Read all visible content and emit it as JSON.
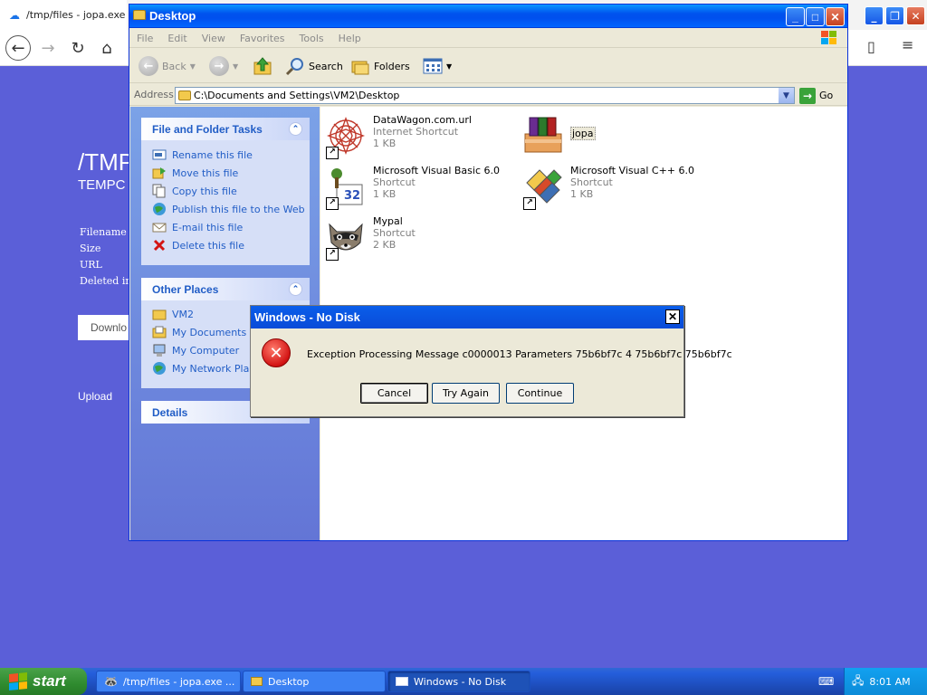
{
  "browser": {
    "tab_title": "/tmp/files - jopa.exe",
    "page_title": "/TMP",
    "page_subtitle": "TEMPC",
    "labels": [
      "Filename",
      "Size",
      "URL",
      "Deleted in"
    ],
    "download_label": "Downlo",
    "upload_label": "Upload"
  },
  "explorer": {
    "title": "Desktop",
    "menu": [
      "File",
      "Edit",
      "View",
      "Favorites",
      "Tools",
      "Help"
    ],
    "toolbar": {
      "back": "Back",
      "search": "Search",
      "folders": "Folders"
    },
    "address_label": "Address",
    "address_value": "C:\\Documents and Settings\\VM2\\Desktop",
    "go_label": "Go",
    "tasks_header": "File and Folder Tasks",
    "tasks": [
      {
        "label": "Rename this file",
        "icon": "rename-icon"
      },
      {
        "label": "Move this file",
        "icon": "move-icon"
      },
      {
        "label": "Copy this file",
        "icon": "copy-icon"
      },
      {
        "label": "Publish this file to the Web",
        "icon": "publish-icon"
      },
      {
        "label": "E-mail this file",
        "icon": "email-icon"
      },
      {
        "label": "Delete this file",
        "icon": "delete-icon"
      }
    ],
    "places_header": "Other Places",
    "places": [
      {
        "label": "VM2",
        "icon": "folder-icon"
      },
      {
        "label": "My Documents",
        "icon": "my-documents-icon"
      },
      {
        "label": "My Computer",
        "icon": "my-computer-icon"
      },
      {
        "label": "My Network Places",
        "icon": "network-icon"
      }
    ],
    "details_header": "Details",
    "files": [
      {
        "name": "DataWagon.com.url",
        "type": "Internet Shortcut",
        "size": "1 KB"
      },
      {
        "name": "jopa",
        "type": "",
        "size": ""
      },
      {
        "name": "Microsoft Visual Basic 6.0",
        "type": "Shortcut",
        "size": "1 KB"
      },
      {
        "name": "Microsoft Visual C++ 6.0",
        "type": "Shortcut",
        "size": "1 KB"
      },
      {
        "name": "Mypal",
        "type": "Shortcut",
        "size": "2 KB"
      }
    ]
  },
  "dialog": {
    "title": "Windows - No Disk",
    "message": "Exception Processing Message c0000013 Parameters 75b6bf7c 4 75b6bf7c 75b6bf7c",
    "buttons": [
      "Cancel",
      "Try Again",
      "Continue"
    ]
  },
  "taskbar": {
    "start_label": "start",
    "tasks": [
      "/tmp/files - jopa.exe ...",
      "Desktop",
      "Windows - No Disk"
    ],
    "clock": "8:01 AM"
  },
  "colors": {
    "browser_bg": "#5b5fd8",
    "xp_title_blue": "#0053ee",
    "task_link": "#215dc6"
  }
}
